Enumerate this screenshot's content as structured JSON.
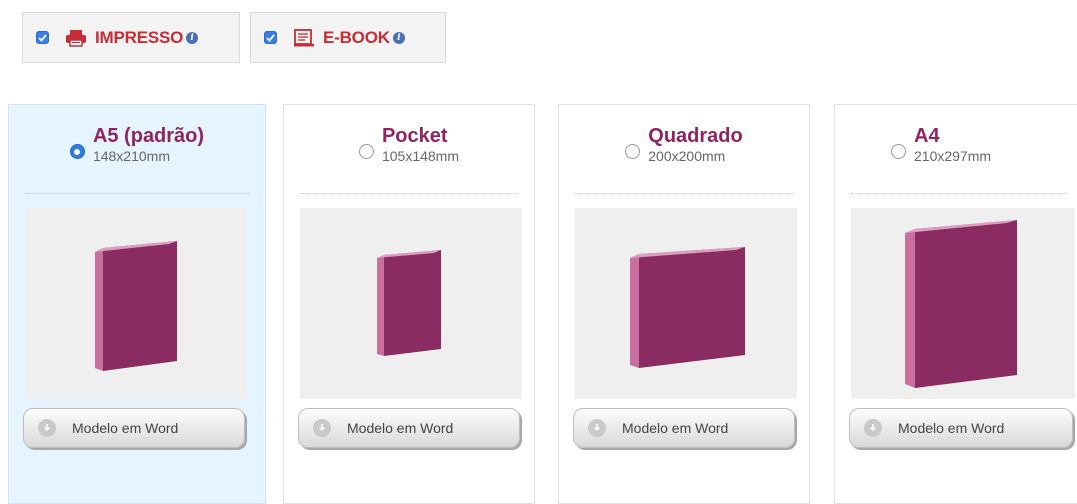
{
  "formats": [
    {
      "label": "IMPRESSO",
      "icon": "printer-icon",
      "checked": true
    },
    {
      "label": "E-BOOK",
      "icon": "ebook-reader-icon",
      "checked": true
    }
  ],
  "sizes": [
    {
      "name": "A5 (padrão)",
      "dims": "148x210mm",
      "selected": true,
      "button": "Modelo em Word"
    },
    {
      "name": "Pocket",
      "dims": "105x148mm",
      "selected": false,
      "button": "Modelo em Word"
    },
    {
      "name": "Quadrado",
      "dims": "200x200mm",
      "selected": false,
      "button": "Modelo em Word"
    },
    {
      "name": "A4",
      "dims": "210x297mm",
      "selected": false,
      "button": "Modelo em Word"
    }
  ],
  "colors": {
    "accent_red": "#c62d36",
    "title_purple": "#8e2562",
    "selected_bg": "#e6f4ff",
    "book_purple": "#8a2b62"
  }
}
